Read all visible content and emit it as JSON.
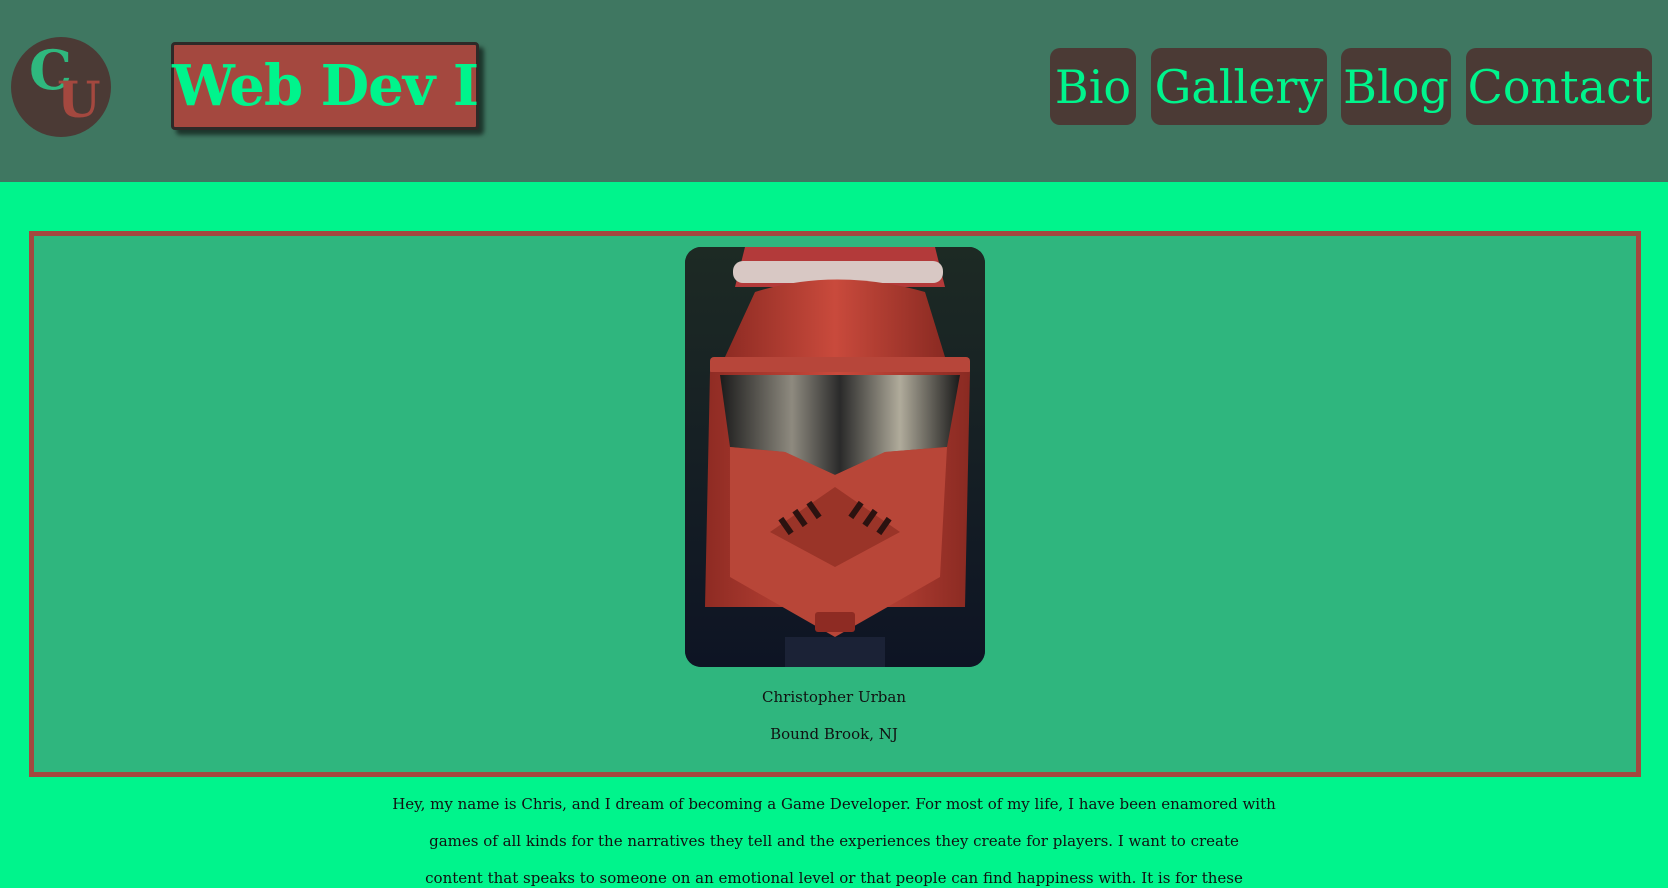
{
  "header": {
    "logo_letters": [
      "C",
      "U"
    ],
    "title": "Web Dev I",
    "nav": [
      {
        "label": "Bio"
      },
      {
        "label": "Gallery"
      },
      {
        "label": "Blog"
      },
      {
        "label": "Contact"
      }
    ]
  },
  "profile": {
    "photo_icon": "red-helmet-photo",
    "name": "Christopher Urban",
    "location": "Bound Brook, NJ"
  },
  "bio": {
    "lines": [
      "Hey, my name is Chris, and I dream of becoming a Game Developer. For most of my life, I have been enamored with",
      "games of all kinds for the narratives they tell and the experiences they create for players. I want to create",
      "content that speaks to someone on an emotional level or that people can find happiness with. It is for these"
    ]
  },
  "colors": {
    "page_background": "#00f48c",
    "header_background": "#3f7761",
    "accent_red": "#a4483f",
    "nav_button_background": "#4b3a35",
    "card_background": "#2fb67e"
  }
}
